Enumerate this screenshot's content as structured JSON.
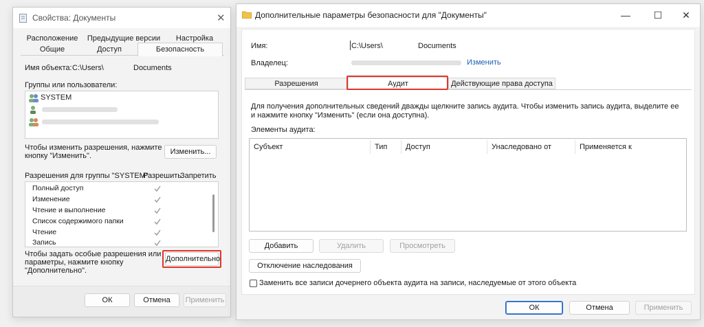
{
  "left_window": {
    "title": "Свойства: Документы",
    "tabs_row1": [
      "Расположение",
      "Предыдущие версии",
      "Настройка"
    ],
    "tabs_row2": [
      "Общие",
      "Доступ",
      "Безопасность"
    ],
    "object_name_label": "Имя объекта:",
    "object_name_prefix": "C:\\Users\\",
    "object_name_suffix": "Documents",
    "groups_label": "Группы или пользователи:",
    "users": [
      "SYSTEM"
    ],
    "change_hint": "Чтобы изменить разрешения, нажмите кнопку \"Изменить\".",
    "change_button": "Изменить...",
    "perm_header": "Разрешения для группы \"SYSTEM\"",
    "allow_label": "Разрешить",
    "deny_label": "Запретить",
    "permissions": [
      "Полный доступ",
      "Изменение",
      "Чтение и выполнение",
      "Список содержимого папки",
      "Чтение",
      "Запись"
    ],
    "special_hint": "Чтобы задать особые разрешения или параметры, нажмите кнопку \"Дополнительно\".",
    "advanced_button": "Дополнительно",
    "ok_button": "ОК",
    "cancel_button": "Отмена",
    "apply_button": "Применить"
  },
  "right_window": {
    "title": "Дополнительные параметры безопасности  для \"Документы\"",
    "name_label": "Имя:",
    "name_prefix": "C:\\Users\\",
    "name_suffix": "Documents",
    "owner_label": "Владелец:",
    "owner_change_link": "Изменить",
    "tabs": [
      "Разрешения",
      "Аудит",
      "Действующие права доступа"
    ],
    "info_text": "Для получения дополнительных сведений дважды щелкните запись аудита. Чтобы изменить запись аудита, выделите ее и нажмите кнопку \"Изменить\" (если она доступна).",
    "audit_items_label": "Элементы аудита:",
    "columns": [
      "Субъект",
      "Тип",
      "Доступ",
      "Унаследовано от",
      "Применяется к"
    ],
    "add_button": "Добавить",
    "delete_button": "Удалить",
    "view_button": "Просмотреть",
    "disable_inheritance_button": "Отключение наследования",
    "replace_checkbox_label": "Заменить все записи дочернего объекта аудита на записи, наследуемые от этого объекта",
    "ok_button": "ОК",
    "cancel_button": "Отмена",
    "apply_button": "Применить"
  },
  "colors": {
    "highlight": "#e0362a",
    "link": "#1a5fb4",
    "folder": "#f2c14e"
  }
}
